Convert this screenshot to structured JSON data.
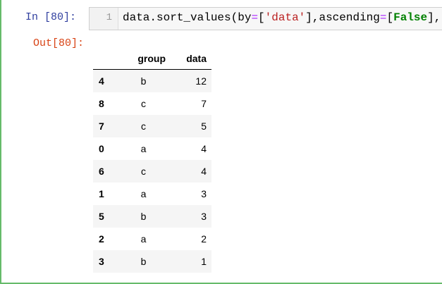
{
  "input_prompt": "In  [80]:",
  "output_prompt": "Out[80]:",
  "line_number": "1",
  "code_tokens": [
    {
      "text": "data.sort_values(by",
      "cls": ""
    },
    {
      "text": "=",
      "cls": "tok-op"
    },
    {
      "text": "[",
      "cls": "tok-brk"
    },
    {
      "text": "'data'",
      "cls": "tok-str"
    },
    {
      "text": "],ascending",
      "cls": ""
    },
    {
      "text": "=",
      "cls": "tok-op"
    },
    {
      "text": "[",
      "cls": "tok-brk"
    },
    {
      "text": "False",
      "cls": "tok-kw"
    },
    {
      "text": "],)",
      "cls": ""
    }
  ],
  "table": {
    "columns": [
      "",
      "group",
      "data"
    ],
    "rows": [
      {
        "index": "4",
        "group": "b",
        "data": "12"
      },
      {
        "index": "8",
        "group": "c",
        "data": "7"
      },
      {
        "index": "7",
        "group": "c",
        "data": "5"
      },
      {
        "index": "0",
        "group": "a",
        "data": "4"
      },
      {
        "index": "6",
        "group": "c",
        "data": "4"
      },
      {
        "index": "1",
        "group": "a",
        "data": "3"
      },
      {
        "index": "5",
        "group": "b",
        "data": "3"
      },
      {
        "index": "2",
        "group": "a",
        "data": "2"
      },
      {
        "index": "3",
        "group": "b",
        "data": "1"
      }
    ]
  },
  "colors": {
    "cell_border": "#66bb6a",
    "input_prompt": "#303f9f",
    "output_prompt": "#d84315",
    "string": "#ba2121",
    "keyword": "#008000",
    "operator": "#aa22ff"
  }
}
